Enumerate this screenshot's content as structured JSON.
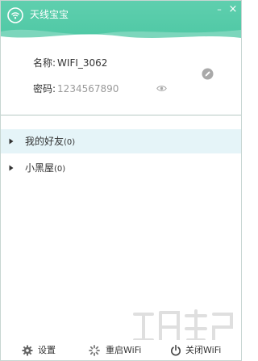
{
  "app": {
    "title": "天线宝宝"
  },
  "window_controls": {
    "minimize": "–",
    "close": "×"
  },
  "wifi_info": {
    "name_label": "名称:",
    "name_value": "WIFI_3062",
    "password_label": "密码:",
    "password_value": "1234567890"
  },
  "groups": [
    {
      "label": "我的好友",
      "count": "(0)",
      "selected": true
    },
    {
      "label": "小黑屋",
      "count": "(0)",
      "selected": false
    }
  ],
  "footer": {
    "settings": "设置",
    "restart": "重启WiFi",
    "close_wifi": "关闭WiFi"
  },
  "colors": {
    "accent": "#4cc7a3",
    "selected_row": "#e5f4f8",
    "border": "#c7d6d2"
  },
  "icons": [
    "wifi-logo-icon",
    "minimize-icon",
    "close-icon",
    "eye-icon",
    "edit-icon",
    "chevron-right-icon",
    "gear-icon",
    "spinner-icon",
    "power-icon"
  ]
}
